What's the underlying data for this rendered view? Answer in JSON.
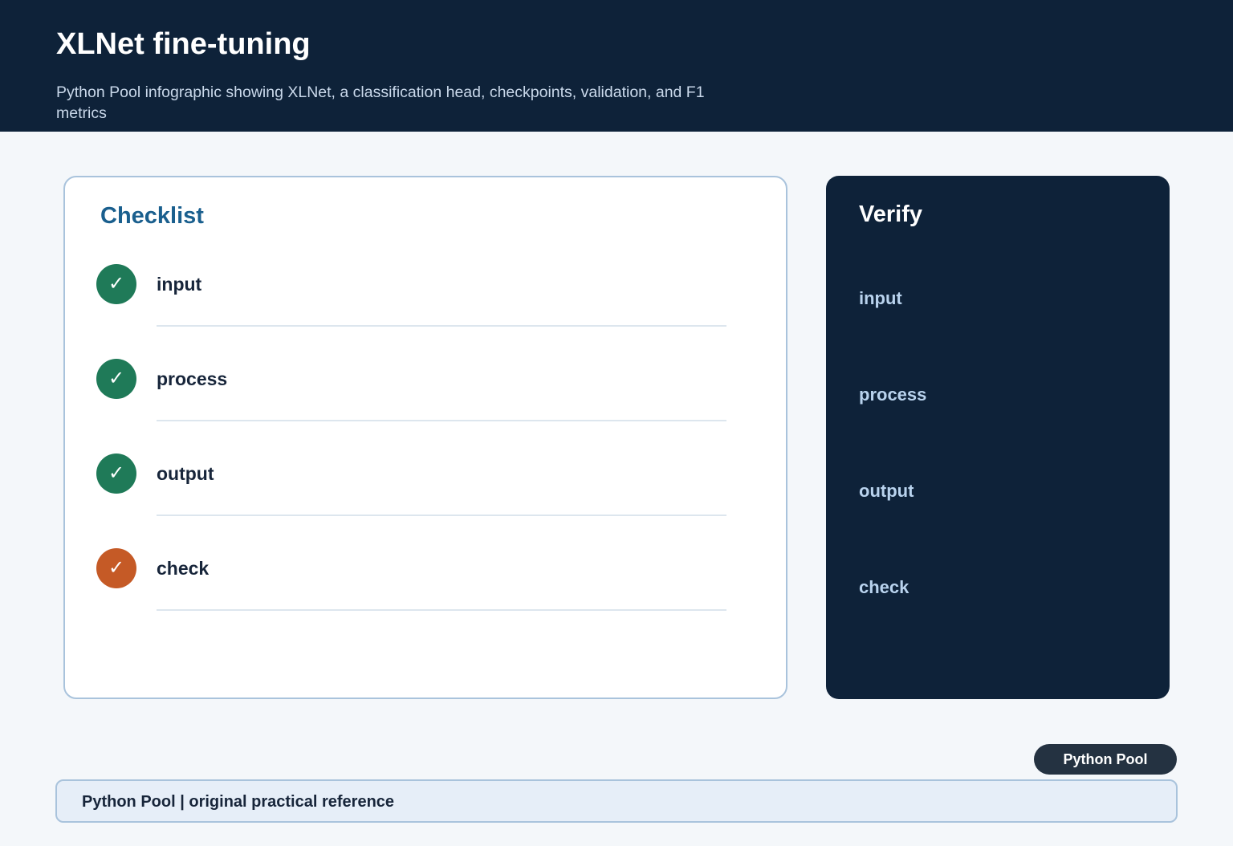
{
  "header": {
    "title": "XLNet fine-tuning",
    "subtitle": "Python Pool infographic showing XLNet, a classification head, checkpoints, validation, and F1 metrics"
  },
  "checklist": {
    "title": "Checklist",
    "items": [
      {
        "label": "input",
        "status": "done",
        "icon": "check-icon"
      },
      {
        "label": "process",
        "status": "done",
        "icon": "check-icon"
      },
      {
        "label": "output",
        "status": "done",
        "icon": "check-icon"
      },
      {
        "label": "check",
        "status": "warning",
        "icon": "check-icon"
      }
    ]
  },
  "verify": {
    "title": "Verify",
    "items": [
      "input",
      "process",
      "output",
      "check"
    ]
  },
  "badge": {
    "label": "Python Pool"
  },
  "footer": {
    "text": "Python Pool | original practical reference"
  },
  "colors": {
    "header_bg": "#0e2239",
    "accent_title": "#1a5f8e",
    "done": "#1f7a58",
    "warning": "#c55a26"
  }
}
